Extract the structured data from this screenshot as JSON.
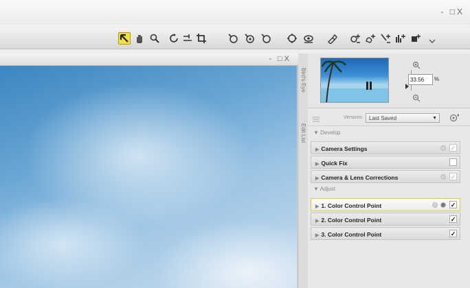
{
  "window": {
    "controls": "- □X"
  },
  "toolbar": {
    "tools": [
      {
        "name": "arrow-select-icon",
        "active": true
      },
      {
        "name": "hand-pan-icon"
      },
      {
        "name": "zoom-tool-icon"
      },
      {
        "name": "rotate-icon"
      },
      {
        "name": "straighten-icon"
      },
      {
        "name": "crop-icon"
      },
      {
        "name": "color-control-point-icon"
      },
      {
        "name": "black-control-point-icon"
      },
      {
        "name": "white-control-point-icon"
      },
      {
        "name": "red-eye-icon"
      },
      {
        "name": "auto-retouch-icon"
      },
      {
        "name": "brush-icon"
      },
      {
        "name": "add-control-point-icon"
      },
      {
        "name": "add-selection-icon"
      },
      {
        "name": "add-line-icon"
      },
      {
        "name": "add-levels-icon"
      },
      {
        "name": "add-grid-icon"
      }
    ]
  },
  "document": {
    "controls": "- □X"
  },
  "side_tabs": {
    "birds_eye": "Bird's Eye",
    "edit_list": "Edit List"
  },
  "birdseye": {
    "zoom_value": "33.56",
    "zoom_unit": "%"
  },
  "edit_list": {
    "versions_label": "Versions",
    "versions_value": "Last Saved",
    "develop_header": "Develop",
    "develop_items": [
      {
        "label": "Camera Settings",
        "checked": true,
        "dim": true
      },
      {
        "label": "Quick Fix",
        "checked": false,
        "dim": false
      },
      {
        "label": "Camera & Lens Corrections",
        "checked": true,
        "dim": true
      }
    ],
    "adjust_header": "Adjust",
    "adjust_items": [
      {
        "label": "1. Color Control Point",
        "checked": true,
        "highlight": true
      },
      {
        "label": "2. Color Control Point",
        "checked": true,
        "highlight": false
      },
      {
        "label": "3. Color Control Point",
        "checked": true,
        "highlight": false
      }
    ]
  }
}
